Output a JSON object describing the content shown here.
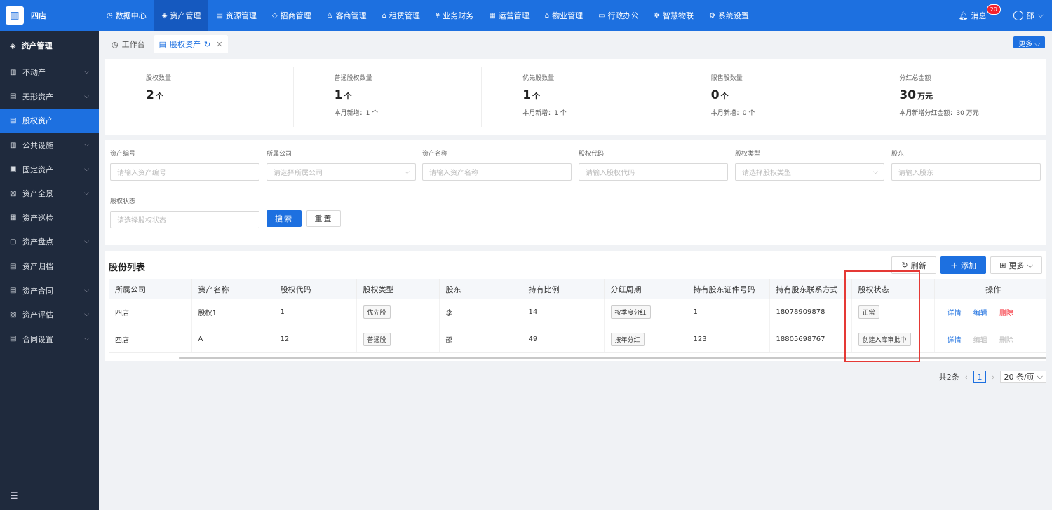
{
  "app": {
    "logo_text": "四店"
  },
  "nav": {
    "items": [
      {
        "icon": "◷",
        "label": "数据中心"
      },
      {
        "icon": "◈",
        "label": "资产管理"
      },
      {
        "icon": "▤",
        "label": "资源管理"
      },
      {
        "icon": "◇",
        "label": "招商管理"
      },
      {
        "icon": "♙",
        "label": "客商管理"
      },
      {
        "icon": "⌂",
        "label": "租赁管理"
      },
      {
        "icon": "¥",
        "label": "业务财务"
      },
      {
        "icon": "▦",
        "label": "运营管理"
      },
      {
        "icon": "⌂",
        "label": "物业管理"
      },
      {
        "icon": "▭",
        "label": "行政办公"
      },
      {
        "icon": "✲",
        "label": "智慧物联"
      },
      {
        "icon": "⚙",
        "label": "系统设置"
      }
    ],
    "active_index": 1,
    "messages_label": "消息",
    "messages_count": "20",
    "user_name": "邵"
  },
  "sidebar": {
    "title": "资产管理",
    "items": [
      {
        "label": "不动产",
        "icon": "▥"
      },
      {
        "label": "无形资产",
        "icon": "▤"
      },
      {
        "label": "股权资产",
        "icon": "▤"
      },
      {
        "label": "公共设施",
        "icon": "▥"
      },
      {
        "label": "固定资产",
        "icon": "▣"
      },
      {
        "label": "资产全景",
        "icon": "▨"
      },
      {
        "label": "资产巡检",
        "icon": "▦"
      },
      {
        "label": "资产盘点",
        "icon": "▢"
      },
      {
        "label": "资产归档",
        "icon": "▤"
      },
      {
        "label": "资产合同",
        "icon": "▤"
      },
      {
        "label": "资产评估",
        "icon": "▨"
      },
      {
        "label": "合同设置",
        "icon": "▤"
      }
    ],
    "active_index": 2
  },
  "tabs": {
    "items": [
      {
        "label": "工作台"
      },
      {
        "label": "股权资产"
      }
    ],
    "more_label": "更多"
  },
  "stats": [
    {
      "label": "股权数量",
      "value": "2",
      "unit": "个",
      "sub": ""
    },
    {
      "label": "普通股权数量",
      "value": "1",
      "unit": "个",
      "sub": "本月新增：1 个"
    },
    {
      "label": "优先股数量",
      "value": "1",
      "unit": "个",
      "sub": "本月新增：1 个"
    },
    {
      "label": "限售股数量",
      "value": "0",
      "unit": "个",
      "sub": "本月新增：0 个"
    },
    {
      "label": "分红总金额",
      "value": "30",
      "unit": "万元",
      "sub": "本月新增分红金额：30 万元"
    }
  ],
  "filters": {
    "asset_no": {
      "label": "资产编号",
      "placeholder": "请输入资产编号"
    },
    "company": {
      "label": "所属公司",
      "placeholder": "请选择所属公司"
    },
    "asset_name": {
      "label": "资产名称",
      "placeholder": "请输入资产名称"
    },
    "equity_code": {
      "label": "股权代码",
      "placeholder": "请输入股权代码"
    },
    "equity_type": {
      "label": "股权类型",
      "placeholder": "请选择股权类型"
    },
    "shareholder": {
      "label": "股东",
      "placeholder": "请输入股东"
    },
    "equity_status": {
      "label": "股权状态",
      "placeholder": "请选择股权状态"
    },
    "search_label": "搜索",
    "reset_label": "重置"
  },
  "list": {
    "title": "股份列表",
    "refresh_label": "刷新",
    "add_label": "添加",
    "more_label": "更多",
    "columns": [
      "所属公司",
      "资产名称",
      "股权代码",
      "股权类型",
      "股东",
      "持有比例",
      "分红周期",
      "持有股东证件号码",
      "持有股东联系方式",
      "股权状态",
      "操作"
    ],
    "rows": [
      {
        "company": "四店",
        "asset_name": "股权1",
        "code": "1",
        "type": "优先股",
        "holder": "李",
        "ratio": "14",
        "cycle": "按季度分红",
        "id_no": "1",
        "phone": "18078909878",
        "status": "正常",
        "ops": [
          "详情",
          "编辑",
          "删除"
        ]
      },
      {
        "company": "四店",
        "asset_name": "A",
        "code": "12",
        "type": "普通股",
        "holder": "邵",
        "ratio": "49",
        "cycle": "按年分红",
        "id_no": "123",
        "phone": "18805698767",
        "status": "创建入库审批中",
        "ops": [
          "详情",
          "编辑",
          "删除"
        ]
      }
    ]
  },
  "pager": {
    "total_label": "共2条",
    "current": "1",
    "size_label": "20 条/页"
  }
}
